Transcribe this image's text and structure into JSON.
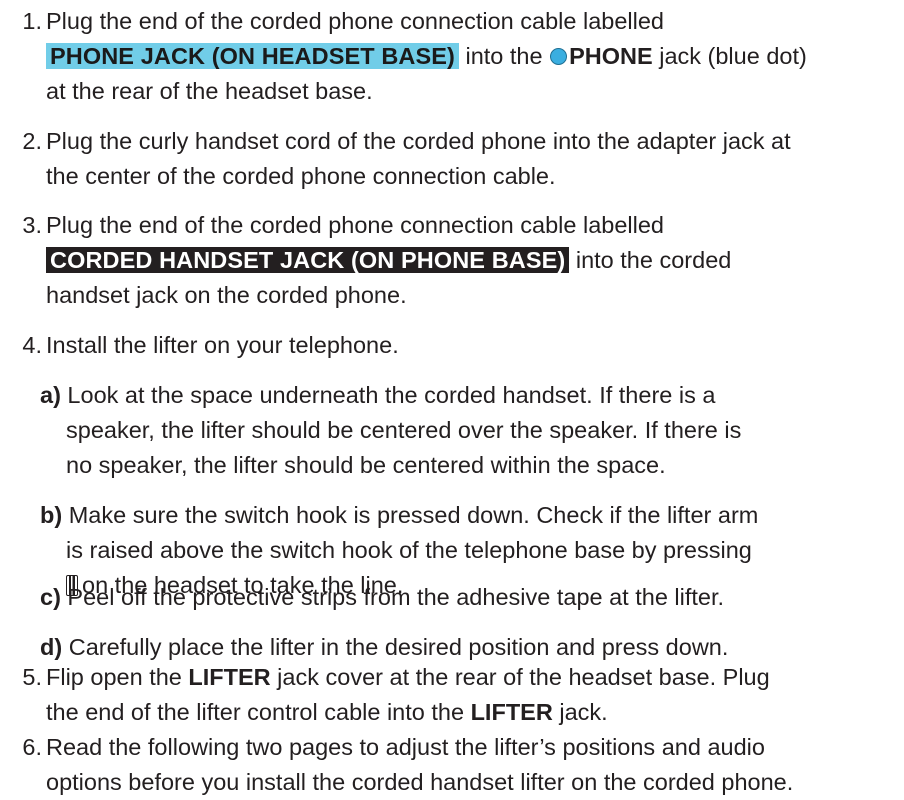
{
  "steps": [
    {
      "num": "1.",
      "t1": "Plug the end of the corded phone connection cable labelled",
      "label": "PHONE JACK (ON HEADSET BASE)",
      "t2": " into the ",
      "bold": "PHONE",
      "t3": " jack (blue dot)",
      "t4": "at the rear of the headset base."
    },
    {
      "num": "2.",
      "line1": "Plug the curly handset cord of the corded phone into the adapter jack at",
      "line2": "the center of the corded phone connection cable."
    },
    {
      "num": "3.",
      "t1": "Plug the end of the corded phone connection cable labelled",
      "label": "CORDED HANDSET JACK (ON PHONE BASE)",
      "t2": " into the corded",
      "t3": "handset jack on the corded phone."
    },
    {
      "num": "4.",
      "text": "Install the lifter on your telephone.",
      "subs": [
        {
          "letter": "a)",
          "line1": " Look at the space underneath the corded handset. If there is a",
          "line2": "speaker, the lifter should be centered over the speaker. If there is",
          "line3": "no speaker, the lifter should be centered within the space."
        },
        {
          "letter": "b)",
          "line1": " Make sure the switch hook is pressed down. Check if the lifter arm",
          "line2": "is raised above the switch hook of the telephone base by pressing",
          "line3": "on the headset to take the line."
        },
        {
          "letter": "c)",
          "line1": " Peel off the protective strips from the adhesive tape at the lifter."
        },
        {
          "letter": "d)",
          "line1": " Carefully place the lifter in the desired position and press down."
        }
      ]
    },
    {
      "num": "5.",
      "t1": "Flip open the ",
      "b1": "LIFTER",
      "t2": " jack cover at the rear of the headset base. Plug",
      "t3": "the end of the lifter control cable into the ",
      "b2": "LIFTER",
      "t4": " jack."
    },
    {
      "num": "6.",
      "line1": "Read the following two pages to adjust the lifter’s positions and audio",
      "line2": "options before you install the corded handset lifter on the corded phone."
    }
  ],
  "colors": {
    "label_cyan": "#71cde8",
    "label_black": "#231f20",
    "blue_dot": "#3aaee0"
  },
  "icons": {
    "phone_jack_marker": "blue-dot-icon",
    "talk_button": "talk-button-icon"
  }
}
